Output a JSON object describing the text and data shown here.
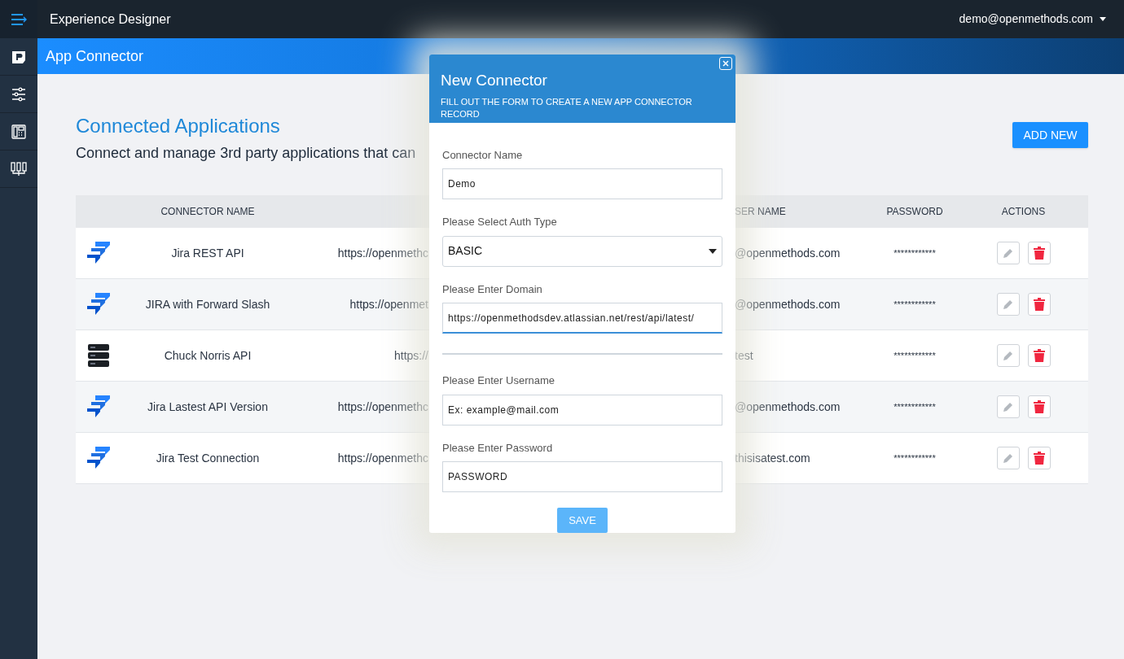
{
  "topbar": {
    "title": "Experience Designer",
    "user": "demo@openmethods.com"
  },
  "band": {
    "title": "App Connector"
  },
  "page": {
    "heading": "Connected Applications",
    "subtitle": "Connect and manage 3rd party applications that can",
    "add_button": "ADD NEW"
  },
  "table": {
    "columns": [
      "CONNECTOR NAME",
      "SER NAME",
      "PASSWORD",
      "ACTIONS"
    ],
    "rows": [
      {
        "kind": "jira",
        "name": "Jira REST API",
        "domain": "https://openmethc",
        "username": "@openmethods.com",
        "password": "************"
      },
      {
        "kind": "jira",
        "name": "JIRA with Forward Slash",
        "domain": "https://openmet",
        "username": "@openmethods.com",
        "password": "************"
      },
      {
        "kind": "server",
        "name": "Chuck Norris API",
        "domain": "https://",
        "username": "test",
        "password": "************"
      },
      {
        "kind": "jira",
        "name": "Jira Lastest API Version",
        "domain": "https://openmethc",
        "username": "@openmethods.com",
        "password": "************"
      },
      {
        "kind": "jira",
        "name": "Jira Test Connection",
        "domain": "https://openmethc",
        "username": "thisisatest.com",
        "password": "************"
      }
    ]
  },
  "modal": {
    "title": "New Connector",
    "subtitle": "FILL OUT THE FORM TO CREATE A NEW APP CONNECTOR RECORD",
    "fields": [
      {
        "kind": "text",
        "label": "Connector Name",
        "value": "Demo",
        "focused": false
      },
      {
        "kind": "select",
        "label": "Please Select Auth Type",
        "value": "BASIC",
        "focused": false
      },
      {
        "kind": "text",
        "label": "Please Enter Domain",
        "value": "https://openmethodsdev.atlassian.net/rest/api/latest/",
        "focused": true
      },
      {
        "kind": "divider"
      },
      {
        "kind": "text",
        "label": "Please Enter Username",
        "placeholder": "Ex: example@mail.com",
        "focused": false
      },
      {
        "kind": "text",
        "label": "Please Enter Password",
        "placeholder": "PASSWORD",
        "focused": false
      }
    ],
    "save_button": "SAVE"
  }
}
